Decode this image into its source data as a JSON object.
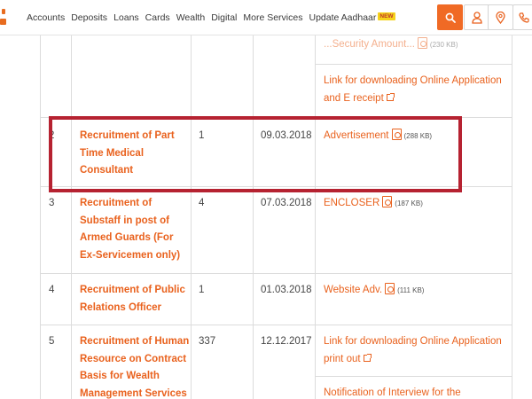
{
  "nav": {
    "items": [
      "Accounts",
      "Deposits",
      "Loans",
      "Cards",
      "Wealth",
      "Digital",
      "More Services",
      "Update Aadhaar"
    ],
    "badge": "NEW"
  },
  "header_icons": [
    "search-icon",
    "user-icon",
    "location-icon",
    "phone-icon"
  ],
  "colors": {
    "accent": "#f06a25",
    "link": "#e9621e",
    "highlight": "#b62231"
  },
  "rows": [
    {
      "sno": "",
      "title": "",
      "posts": "",
      "date": "",
      "docs": [
        {
          "text": "...Security Amount...",
          "size": "(230 KB)",
          "icon": "pdf-icon"
        },
        {
          "text": "Link for downloading Online Application and E receipt",
          "size": "",
          "icon": "external-link-icon"
        }
      ]
    },
    {
      "sno": "2",
      "title": "Recruitment of Part Time Medical Consultant",
      "posts": "1",
      "date": "09.03.2018",
      "docs": [
        {
          "text": "Advertisement",
          "size": "(288 KB)",
          "icon": "pdf-icon"
        }
      ]
    },
    {
      "sno": "3",
      "title": "Recruitment of Substaff in post of Armed Guards (For Ex-Servicemen only)",
      "posts": "4",
      "date": "07.03.2018",
      "docs": [
        {
          "text": "ENCLOSER",
          "size": "(187 KB)",
          "icon": "pdf-icon"
        }
      ]
    },
    {
      "sno": "4",
      "title": "Recruitment of Public Relations Officer",
      "posts": "1",
      "date": "01.03.2018",
      "docs": [
        {
          "text": "Website Adv.",
          "size": "(111 KB)",
          "icon": "pdf-icon"
        }
      ]
    },
    {
      "sno": "5",
      "title": "Recruitment of Human Resource on Contract Basis for Wealth Management Services",
      "posts": "337",
      "date": "12.12.2017",
      "docs": [
        {
          "text": "Link for downloading Online Application print out",
          "size": "",
          "icon": "external-link-icon"
        },
        {
          "text": "Notification of Interview for the",
          "size": "",
          "icon": ""
        }
      ]
    }
  ]
}
